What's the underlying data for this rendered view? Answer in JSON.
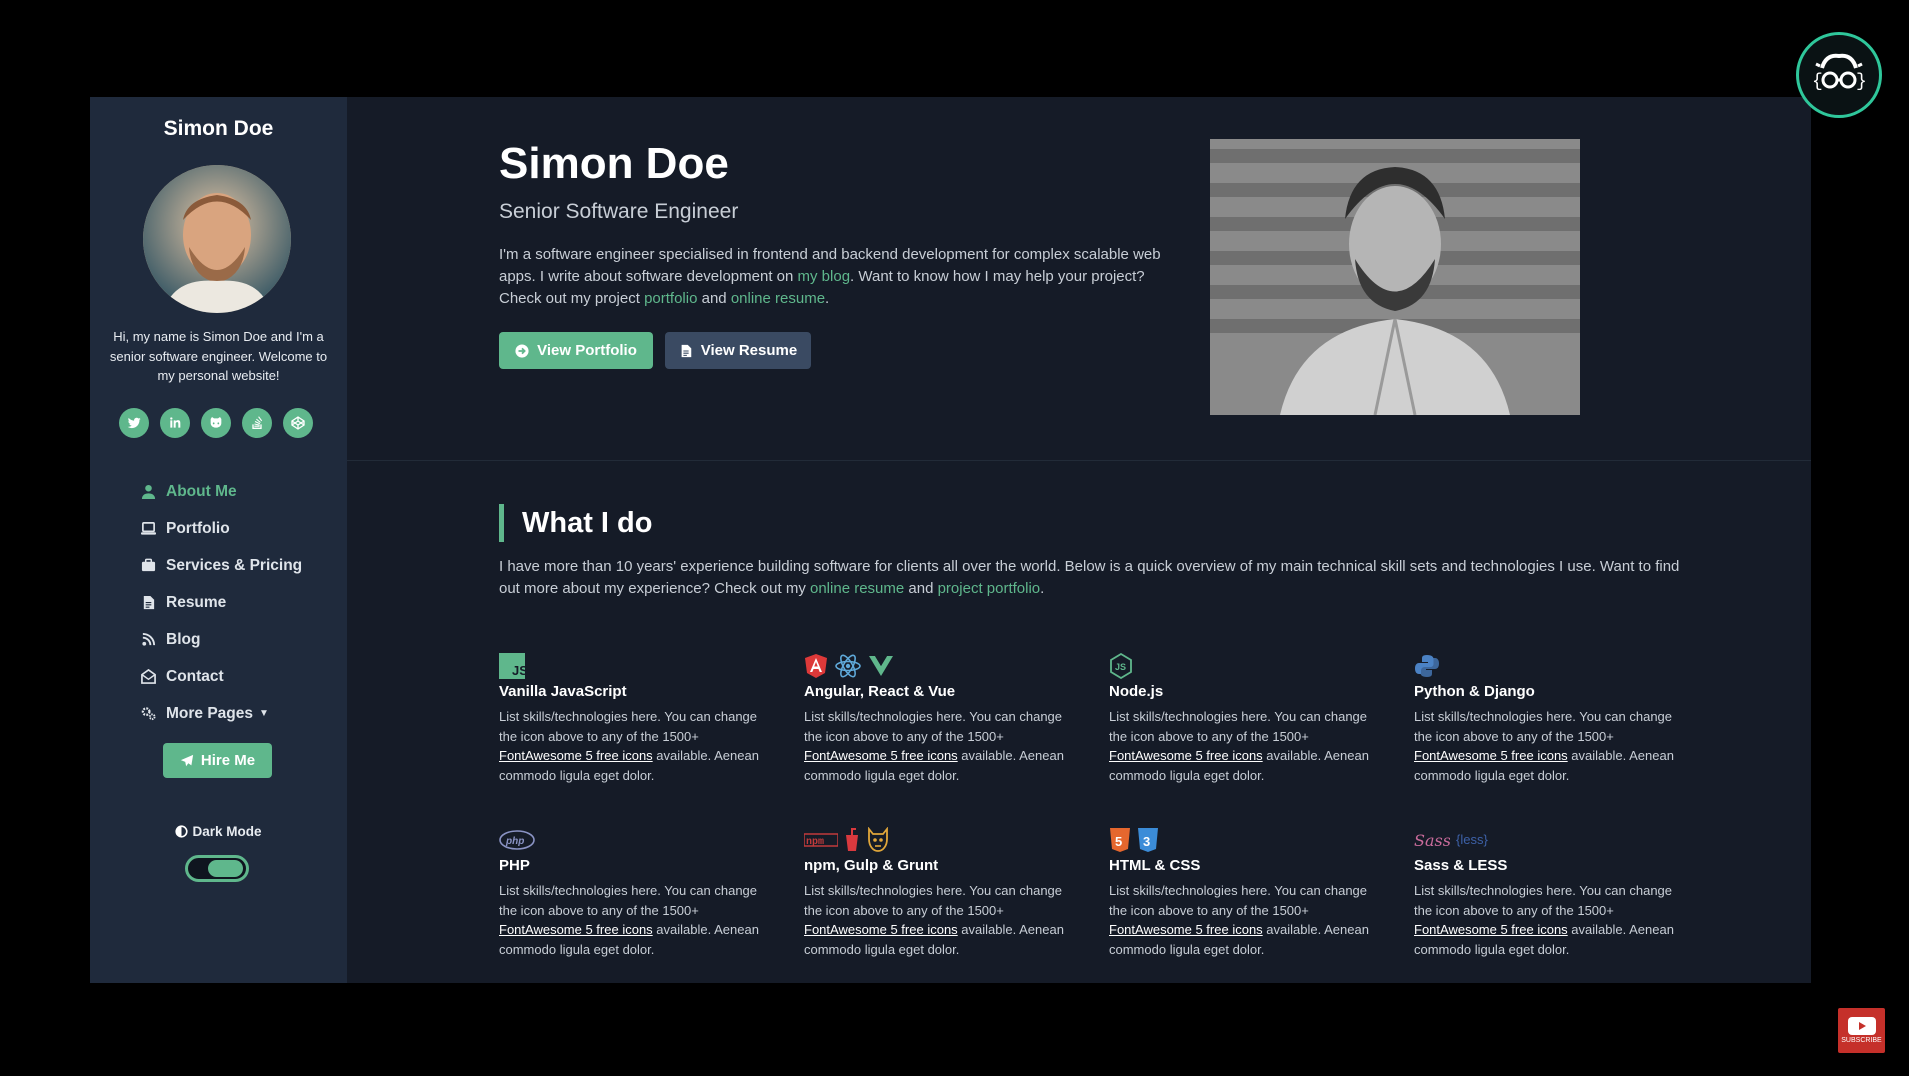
{
  "sidebar": {
    "name": "Simon Doe",
    "bio": "Hi, my name is Simon Doe and I'm a senior software engineer. Welcome to my personal website!",
    "social_icons": [
      "twitter-icon",
      "linkedin-icon",
      "github-icon",
      "stack-overflow-icon",
      "codepen-icon"
    ],
    "nav": [
      {
        "label": "About Me",
        "icon": "user-icon",
        "active": true
      },
      {
        "label": "Portfolio",
        "icon": "laptop-icon"
      },
      {
        "label": "Services & Pricing",
        "icon": "briefcase-icon"
      },
      {
        "label": "Resume",
        "icon": "file-icon"
      },
      {
        "label": "Blog",
        "icon": "blog-icon"
      },
      {
        "label": "Contact",
        "icon": "envelope-open-icon"
      },
      {
        "label": "More Pages",
        "icon": "cogs-icon"
      }
    ],
    "hire_label": "Hire Me",
    "dark_mode_label": "Dark Mode",
    "dark_mode_on": true
  },
  "hero": {
    "title": "Simon Doe",
    "subtitle": "Senior Software Engineer",
    "text_1": "I'm a software engineer specialised in frontend and backend development for complex scalable web apps. I write about software development on ",
    "link_blog": "my blog",
    "text_2": ". Want to know how I may help your project? Check out my project ",
    "link_portfolio": "portfolio",
    "text_3": " and ",
    "link_resume": "online resume",
    "text_4": ".",
    "btn_portfolio": "View Portfolio",
    "btn_resume": "View Resume"
  },
  "what_i_do": {
    "title": "What I do",
    "text_1": "I have more than 10 years' experience building software for clients all over the world. Below is a quick overview of my main technical skill sets and technologies I use. Want to find out more about my experience? Check out my ",
    "link_resume": "online resume",
    "text_2": " and ",
    "link_portfolio": "project portfolio",
    "text_3": ".",
    "skill_text_1": "List skills/technologies here. You can change the icon above to any of the 1500+ ",
    "skill_link": "FontAwesome 5 free icons",
    "skill_text_2": " available. Aenean commodo ligula eget dolor.",
    "skills": [
      {
        "title": "Vanilla JavaScript",
        "icons": [
          "js-icon"
        ]
      },
      {
        "title": "Angular, React & Vue",
        "icons": [
          "angular-icon",
          "react-icon",
          "vue-icon"
        ]
      },
      {
        "title": "Node.js",
        "icons": [
          "nodejs-icon"
        ]
      },
      {
        "title": "Python & Django",
        "icons": [
          "python-icon"
        ]
      },
      {
        "title": "PHP",
        "icons": [
          "php-icon"
        ]
      },
      {
        "title": "npm, Gulp & Grunt",
        "icons": [
          "npm-icon",
          "gulp-icon",
          "grunt-icon"
        ]
      },
      {
        "title": "HTML & CSS",
        "icons": [
          "html5-icon",
          "css3-icon"
        ]
      },
      {
        "title": "Sass & LESS",
        "icons": [
          "sass-icon",
          "less-icon"
        ]
      }
    ]
  },
  "overlay": {
    "youtube_subscribe": "SUBSCRIBE"
  },
  "colors": {
    "accent": "#5fb78c",
    "sidebar_bg": "#1f2a3c",
    "main_bg": "#151b27"
  }
}
